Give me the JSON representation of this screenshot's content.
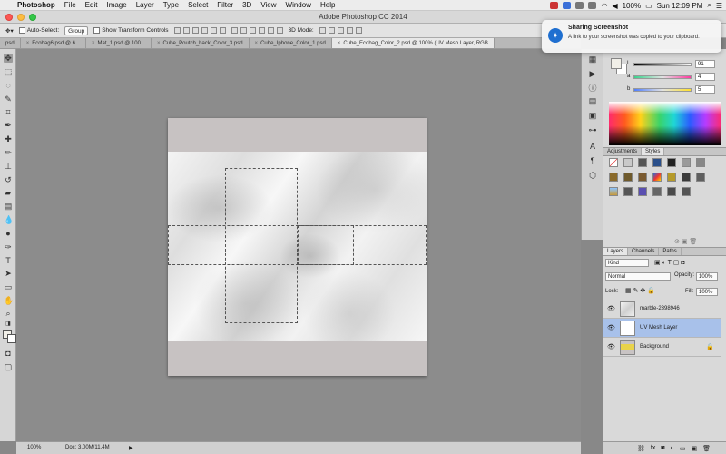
{
  "menubar": {
    "app": "Photoshop",
    "items": [
      "File",
      "Edit",
      "Image",
      "Layer",
      "Type",
      "Select",
      "Filter",
      "3D",
      "View",
      "Window",
      "Help"
    ],
    "battery": "100%",
    "clock": "Sun 12:09 PM"
  },
  "window": {
    "title": "Adobe Photoshop CC 2014"
  },
  "options": {
    "auto_select_label": "Auto-Select:",
    "auto_select_value": "Group",
    "transform_label": "Show Transform Controls",
    "mode_label": "3D Mode:"
  },
  "tabs": [
    {
      "label": "psd"
    },
    {
      "label": "Ecobag6.psd @ 6..."
    },
    {
      "label": "Mat_1.psd @ 100..."
    },
    {
      "label": "Cube_Poutch_back_Color_3.psd"
    },
    {
      "label": "Cube_Iphone_Color_1.psd"
    },
    {
      "label": "Cube_Ecobag_Color_2.psd @ 100% (UV Mesh Layer, RGB"
    }
  ],
  "notification": {
    "title": "Sharing Screenshot",
    "body": "A link to your screenshot was copied to your clipboard."
  },
  "color_panel": {
    "sliders": [
      {
        "label": "L",
        "value": "91"
      },
      {
        "label": "a",
        "value": "4"
      },
      {
        "label": "b",
        "value": "5"
      }
    ]
  },
  "panel_tabs": {
    "adjustments": "Adjustments",
    "styles": "Styles",
    "layers": "Layers",
    "channels": "Channels",
    "paths": "Paths"
  },
  "layers_panel": {
    "kind": "Kind",
    "blend": "Normal",
    "opacity_label": "Opacity:",
    "opacity": "100%",
    "lock_label": "Lock:",
    "fill_label": "Fill:",
    "fill": "100%",
    "layers": [
      {
        "name": "marble-2398946"
      },
      {
        "name": "UV Mesh Layer"
      },
      {
        "name": "Background"
      }
    ]
  },
  "status": {
    "zoom": "100%",
    "doc": "Doc: 3.00M/11.4M"
  }
}
